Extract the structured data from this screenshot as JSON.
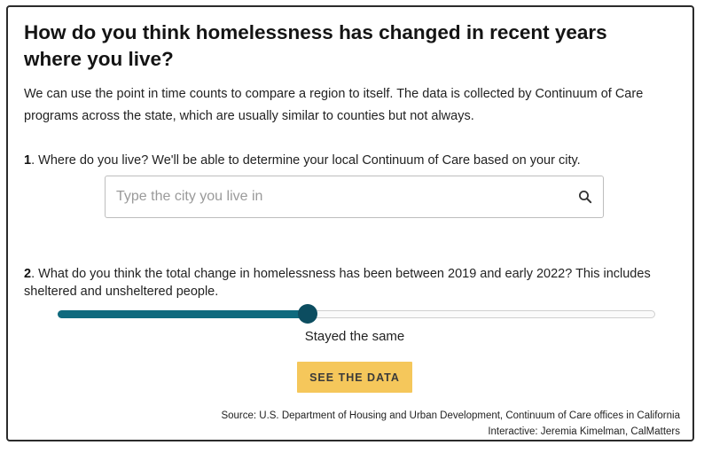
{
  "header": {
    "title": "How do you think homelessness has changed in recent years where you live?"
  },
  "intro": {
    "text": "We can use the point in time counts to compare a region to itself. The data is collected by Continuum of Care programs across the state, which are usually similar to counties but not always."
  },
  "question1": {
    "number": "1",
    "text": ". Where do you live? We'll be able to determine your local Continuum of Care based on your city.",
    "search": {
      "value": "",
      "placeholder": "Type the city you live in",
      "icon": "search-icon"
    }
  },
  "question2": {
    "number": "2",
    "text": ". What do you think the total change in homelessness has been between 2019 and early 2022? This includes sheltered and unsheltered people.",
    "slider": {
      "value_fraction": 0.5,
      "value_label": "Stayed the same",
      "fill_color": "#0f6a7e",
      "thumb_color": "#0c4d60"
    }
  },
  "cta": {
    "label": "SEE THE DATA",
    "color": "#f5c75b"
  },
  "footer": {
    "source": "Source: U.S. Department of Housing and Urban Development, Continuum of Care offices in California",
    "credit": "Interactive: Jeremia Kimelman, CalMatters"
  }
}
